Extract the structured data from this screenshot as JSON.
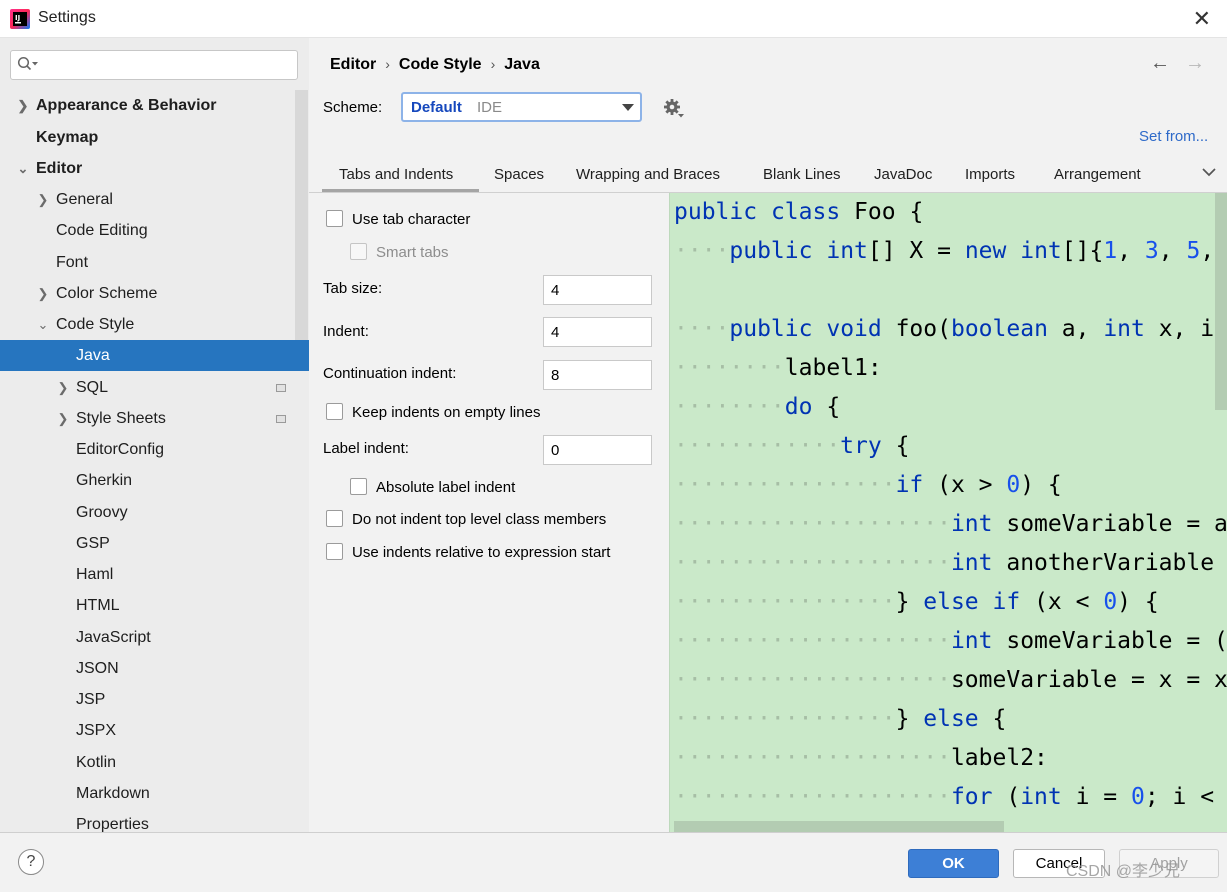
{
  "window": {
    "title": "Settings"
  },
  "search": {
    "placeholder": ""
  },
  "sidebar": {
    "items": [
      {
        "label": "Appearance & Behavior"
      },
      {
        "label": "Keymap"
      },
      {
        "label": "Editor"
      },
      {
        "label": "General"
      },
      {
        "label": "Code Editing"
      },
      {
        "label": "Font"
      },
      {
        "label": "Color Scheme"
      },
      {
        "label": "Code Style"
      },
      {
        "label": "Java"
      },
      {
        "label": "SQL"
      },
      {
        "label": "Style Sheets"
      },
      {
        "label": "EditorConfig"
      },
      {
        "label": "Gherkin"
      },
      {
        "label": "Groovy"
      },
      {
        "label": "GSP"
      },
      {
        "label": "Haml"
      },
      {
        "label": "HTML"
      },
      {
        "label": "JavaScript"
      },
      {
        "label": "JSON"
      },
      {
        "label": "JSP"
      },
      {
        "label": "JSPX"
      },
      {
        "label": "Kotlin"
      },
      {
        "label": "Markdown"
      },
      {
        "label": "Properties"
      }
    ]
  },
  "breadcrumb": [
    "Editor",
    "Code Style",
    "Java"
  ],
  "scheme": {
    "label": "Scheme:",
    "name": "Default",
    "kind": "IDE",
    "set_from": "Set from..."
  },
  "tabs": [
    "Tabs and Indents",
    "Spaces",
    "Wrapping and Braces",
    "Blank Lines",
    "JavaDoc",
    "Imports",
    "Arrangement"
  ],
  "options": {
    "use_tab_character": "Use tab character",
    "smart_tabs": "Smart tabs",
    "tab_size_label": "Tab size:",
    "tab_size": "4",
    "indent_label": "Indent:",
    "indent": "4",
    "continuation_indent_label": "Continuation indent:",
    "continuation_indent": "8",
    "keep_indents_empty": "Keep indents on empty lines",
    "label_indent_label": "Label indent:",
    "label_indent": "0",
    "absolute_label_indent": "Absolute label indent",
    "no_indent_top_level": "Do not indent top level class members",
    "indents_relative_expr": "Use indents relative to expression start"
  },
  "code_preview": [
    "public class Foo {",
    "    public int[] X = new int[]{1, 3, 5,",
    "",
    "    public void foo(boolean a, int x, in",
    "        label1:",
    "        do {",
    "            try {",
    "                if (x > 0) {",
    "                    int someVariable = a",
    "                    int anotherVariable",
    "                } else if (x < 0) {",
    "                    int someVariable = (",
    "                    someVariable = x = x",
    "                } else {",
    "                    label2:",
    "                    for (int i = 0; i <",
    "                }"
  ],
  "footer": {
    "help": "?",
    "ok": "OK",
    "cancel": "Cancel",
    "apply": "Apply",
    "watermark": "CSDN @李少兄"
  },
  "colors": {
    "accent": "#2675bf",
    "preview_bg": "#cae9c9",
    "keyword": "#0033b3",
    "number": "#1750eb",
    "scheme_name": "#1648bd",
    "link": "#2e6ac9"
  },
  "icons": {
    "app": "intellij-idea-icon",
    "search": "search-icon",
    "gear": "gear-icon",
    "close": "close-icon",
    "back": "arrow-left-icon",
    "forward": "arrow-right-icon",
    "more_tabs": "chevron-down-icon",
    "help": "help-icon"
  }
}
